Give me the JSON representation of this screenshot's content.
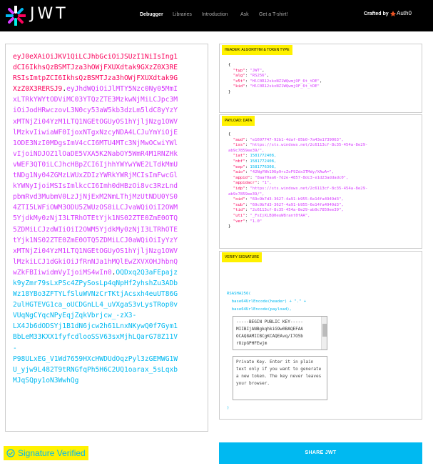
{
  "nav": {
    "logo_text": "JWT",
    "items": [
      "Debugger",
      "Libraries",
      "Introduction",
      "Ask",
      "Get a T-shirt!"
    ],
    "crafted_by": "Crafted by",
    "brand": "Auth0"
  },
  "encoded": {
    "header_lines": [
      "eyJ0eXAiOiJKV1QiLCJhbGciOiJSUzI1NiIsIng1",
      "dCI6IkhsQzBSMTJza3hOWjFXUXdtak9GXzZ0X3RE",
      "RSIsImtpZCI6IkhsQzBSMTJza3hOWjFXUXdtak9G",
      "XzZ0X3RERSJ9"
    ],
    "header_tail_dot": ".",
    "payload_lines": [
      "eyJhdWQiOiJlMTY5Nzc0Ny05MmI",
      "xLTRkYWYtODViMC03YTQzZTE3MzkwNjMiLCJpc3M",
      "iOiJodHRwczovL3N0cy53aW5kb3dzLm5ldC8yYzY",
      "xMTNjZi04YzM1LTQ1NGEtOGUyOS1hYjljNzg1OWV",
      "lMzkvIiwiaWF0IjoxNTgxNzcyNDA4LCJuYmYiOjE",
      "1ODE3NzI0MDgsImV4cCI6MTU4MTc3NjMwOCwiYWl",
      "vIjoiNDJOZ1lOaDE5VXA5K2NabOY5WmR4M1RNZHk",
      "vWEF3QT0iLCJhcHBpZCI6IjhhYWYwYWE2LTdkMmU",
      "tNDg1Ny04ZGMzLWUxZDIzYWRkYWRjMCIsImFwcGl",
      "kYWNyIjoiMSIsImlkcCI6Imh0dHBzOi8vc3RzLnd",
      "pbmRvd3MubmV0LzJjNjExM2NmLThjMzUtNDU0YS0",
      "4ZTI5LWFiOWM3ODU5ZWUzOS8iLCJvaWQiOiI2OWM",
      "5YjdkMy0zNjI3LTRhOTEtYjk1NS02ZTE0ZmE0OTQ",
      "5ZDMiLCJzdWIiOiI2OWM5YjdkMy0zNjI3LTRhOTE",
      "tYjk1NS02ZTE0ZmE0OTQ5ZDMiLCJ0aWQiOiIyYzY",
      "xMTNjZi04YzM1LTQ1NGEtOGUyOS1hYjljNzg1OWV",
      "lMzkiLCJ1dGkiOiJfRnNJa1hMQlEwZXVXOHJhbnQ",
      "wZkFBIiwidmVyIjoiMS4wIn0"
    ],
    "payload_tail_dot": ".",
    "sig_first": "OQDxq2Q3aFEpajz",
    "sig_lines": [
      "k9yZmr79sLxPSc4ZPySosLp4qNpHf2yhshZu3ADb",
      "Wz18YBo3ZFTYLfSluWVNzCrTKtjAcsxh4euUT86G",
      "2ulHGTEVG1ca_oUCDGnLL4_uVXgaS3vLysTRop0v",
      "VUqNgCYqcNPyEqjZqkVbrjcw_-zX3-",
      "LX4Jb6dODSYj1B1dN6jcw2h61LnxNKywQ0f7Gym1",
      "BbLeM33KXX1fyfcdlooSSV63sxMjhLQarG78Z11V",
      "-",
      "P98ULxEG_V1Wd7659HXcHWDUdOqzPyl3zGEMWG1W",
      "U_yjw9L482T9tRNGfqPh5H6C2UQ1oarax_5sLqxb",
      "MJqSQpy1oN3WwhQg"
    ]
  },
  "header_panel": {
    "title": "HEADER: ALGORITHM & TOKEN TYPE",
    "fields": [
      {
        "k": "\"typ\"",
        "v": "\"JWT\""
      },
      {
        "k": "\"alg\"",
        "v": "\"RS256\""
      },
      {
        "k": "\"x5t\"",
        "v": "\"HlC0R12skxNZ1WQwmjOF_6t_tDE\""
      },
      {
        "k": "\"kid\"",
        "v": "\"HlC0R12skxNZ1WQwmjOF_6t_tDE\""
      }
    ]
  },
  "payload_panel": {
    "title": "PAYLOAD: DATA",
    "lines": [
      "  \"aud\": \"e1697747-92b1-4daf-85b0-7a43e1739063\",",
      "  \"iss\": \"https://sts.windows.net/2c6113cf-8c35-454a-8e29-",
      "ab9c7859ee39/\",",
      "  \"iat\": 1581772408,",
      "  \"nbf\": 1581772408,",
      "  \"exp\": 1581776308,",
      "  \"aio\": \"42NgYNh19Up9+cZoF9Zdx3TMdy/XAwA=\",",
      "  \"appid\": \"8aaf0aa6-7d2e-4857-8dc3-e1d23addadc0\",",
      "  \"appidacr\": \"1\",",
      "  \"idp\": \"https://sts.windows.net/2c6113cf-8c35-454a-8e29-",
      "ab9c7859ee39/\",",
      "  \"oid\": \"69c9b7d3-3627-4a91-b955-6e14fa4949d3\",",
      "  \"sub\": \"69c9b7d3-3627-4a91-b955-6e14fa4949d3\",",
      "  \"tid\": \"2c6113cf-8c35-454a-8e29-ab9c7859ee39\",",
      "  \"uti\": \"_FsIjXLBQ0euW8rant0fAA\",",
      "  \"ver\": \"1.0\""
    ]
  },
  "signature_panel": {
    "title": "VERIFY SIGNATURE",
    "line1": "RSASHA256(",
    "line2": "  base64UrlEncode(header) + \".\" +",
    "line3": "  base64UrlEncode(payload),",
    "pubkey_lines": [
      "-----BEGIN PUBLIC KEY-----",
      "MIIBIjANBgkqhkiG9w0BAQEFAA",
      "OCAQ8AMIIBCgKCAQEAvq/I7O5b",
      "rUzpGPHFEwjm"
    ],
    "privkey_text": "Private Key. Enter it in plain text only if you want to generate a new token. The key never leaves your browser.",
    "close": ")"
  },
  "status": {
    "verified": "Signature Verified",
    "share": "SHARE JWT"
  }
}
